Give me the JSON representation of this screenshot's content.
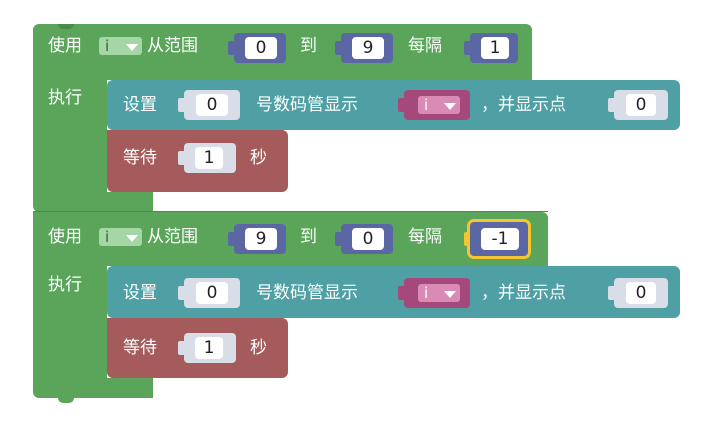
{
  "colors": {
    "loop_green": "#5ba55b",
    "loop_green_dark": "#4a8a4a",
    "teal": "#4ea0a4",
    "teal_dark": "#3f858a",
    "wait_red": "#a55b5b",
    "wait_dark": "#8a4a4a",
    "num_blue": "#5b67a5",
    "var_pink": "#a5497d",
    "highlight": "#f4c531"
  },
  "loop1": {
    "use_label": "使用",
    "var_name": "i",
    "from_label": "从范围",
    "from_value": "0",
    "to_label": "到",
    "to_value": "9",
    "step_label": "每隔",
    "step_value": "1",
    "do_label": "执行",
    "set_label": "设置",
    "digit_index": "0",
    "display_label": "号数码管显示",
    "display_var": "i",
    "dot_label": "，并显示点",
    "dot_value": "0",
    "wait_label": "等待",
    "wait_value": "1",
    "sec_label": "秒"
  },
  "loop2": {
    "use_label": "使用",
    "var_name": "i",
    "from_label": "从范围",
    "from_value": "9",
    "to_label": "到",
    "to_value": "0",
    "step_label": "每隔",
    "step_value": "-1",
    "do_label": "执行",
    "set_label": "设置",
    "digit_index": "0",
    "display_label": "号数码管显示",
    "display_var": "i",
    "dot_label": "，并显示点",
    "dot_value": "0",
    "wait_label": "等待",
    "wait_value": "1",
    "sec_label": "秒"
  }
}
